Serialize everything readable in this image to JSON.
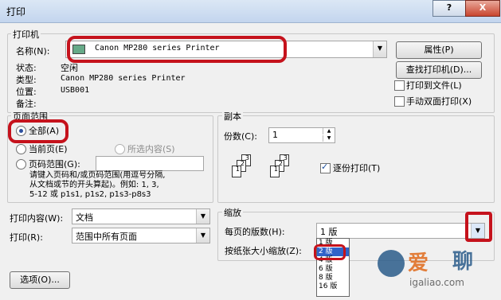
{
  "window": {
    "title": "打印",
    "help": "?",
    "close": "X"
  },
  "printer": {
    "legend": "打印机",
    "name_label": "名称(N):",
    "name_value": "Canon MP280 series Printer",
    "status_label": "状态:",
    "status_value": "空闲",
    "type_label": "类型:",
    "type_value": "Canon MP280 series Printer",
    "location_label": "位置:",
    "location_value": "USB001",
    "comment_label": "备注:",
    "comment_value": "",
    "properties_btn": "属性(P)",
    "find_btn": "查找打印机(D)...",
    "print_to_file": "打印到文件(L)",
    "manual_duplex": "手动双面打印(X)"
  },
  "page_range": {
    "legend": "页面范围",
    "all": "全部(A)",
    "current": "当前页(E)",
    "selection": "所选内容(S)",
    "pages": "页码范围(G):",
    "pages_value": "",
    "hint": [
      "请键入页码和/或页码范围(用逗号分隔,",
      "从文档或节的开头算起)。例如: 1, 3,",
      "5-12 或 p1s1, p1s2, p1s3-p8s3"
    ]
  },
  "copies": {
    "legend": "副本",
    "count_label": "份数(C):",
    "count_value": "1",
    "collate": "逐份打印(T)"
  },
  "print_what": {
    "label": "打印内容(W):",
    "value": "文档"
  },
  "print": {
    "label": "打印(R):",
    "value": "范围中所有页面"
  },
  "zoom": {
    "legend": "缩放",
    "pages_per_sheet_label": "每页的版数(H):",
    "pages_per_sheet_value": "1 版",
    "scale_label": "按纸张大小缩放(Z):",
    "options": [
      "1 版",
      "2 版",
      "4 版",
      "6 版",
      "8 版",
      "16 版"
    ],
    "selected_index": 1
  },
  "options_btn": "选项(O)...",
  "watermark": {
    "text1": "爱",
    "text2": "聊",
    "site": "igaliao.com"
  }
}
